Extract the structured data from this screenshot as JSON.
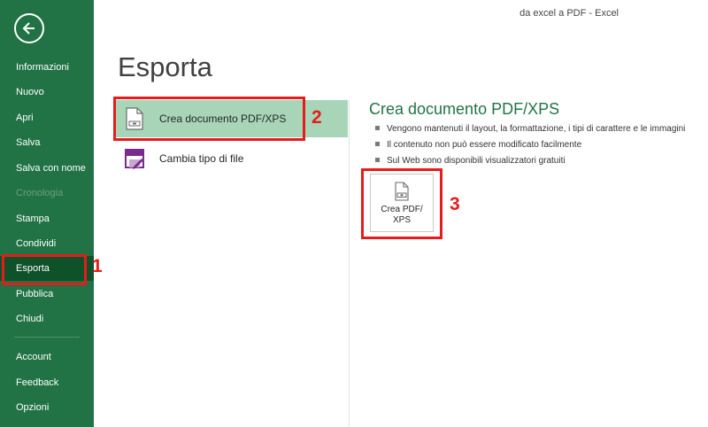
{
  "window": {
    "title": "da excel a PDF  -  Excel"
  },
  "sidebar": {
    "back_icon": "back-arrow-icon",
    "items": [
      {
        "label": "Informazioni",
        "state": "normal"
      },
      {
        "label": "Nuovo",
        "state": "normal"
      },
      {
        "label": "Apri",
        "state": "normal"
      },
      {
        "label": "Salva",
        "state": "normal"
      },
      {
        "label": "Salva con nome",
        "state": "normal"
      },
      {
        "label": "Cronologia",
        "state": "disabled"
      },
      {
        "label": "Stampa",
        "state": "normal"
      },
      {
        "label": "Condividi",
        "state": "normal"
      },
      {
        "label": "Esporta",
        "state": "selected"
      },
      {
        "label": "Pubblica",
        "state": "normal"
      },
      {
        "label": "Chiudi",
        "state": "normal"
      }
    ],
    "bottom_items": [
      {
        "label": "Account"
      },
      {
        "label": "Feedback"
      },
      {
        "label": "Opzioni"
      }
    ]
  },
  "main": {
    "title": "Esporta",
    "options": [
      {
        "label": "Crea documento PDF/XPS",
        "icon": "pdf-document-icon",
        "selected": true
      },
      {
        "label": "Cambia tipo di file",
        "icon": "change-file-type-icon",
        "selected": false
      }
    ]
  },
  "detail": {
    "title": "Crea documento PDF/XPS",
    "bullets": [
      "Vengono mantenuti il layout, la formattazione, i tipi di carattere e le immagini",
      "Il contenuto non può essere modificato facilmente",
      "Sul Web sono disponibili visualizzatori gratuiti"
    ],
    "create_button": {
      "label": "Crea PDF/\nXPS",
      "icon": "pdf-document-icon"
    }
  },
  "annotations": [
    "1",
    "2",
    "3"
  ],
  "colors": {
    "sidebar": "#217346",
    "sidebar_selected": "#0f5129",
    "option_selected": "#a8d5b8",
    "accent_text": "#217346",
    "annotation_red": "#e51c1c"
  }
}
